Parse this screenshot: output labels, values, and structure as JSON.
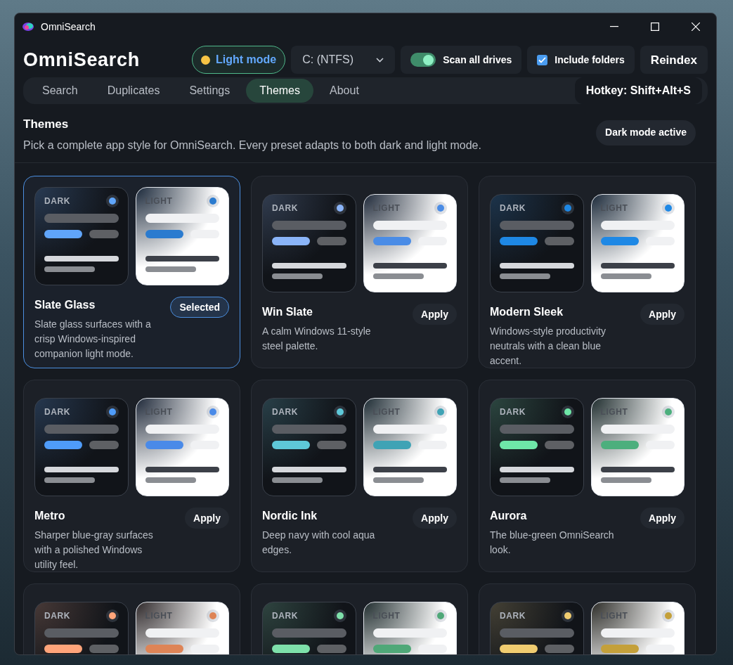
{
  "window": {
    "title": "OmniSearch"
  },
  "app_title": "OmniSearch",
  "toolbar": {
    "mode_button": {
      "label": "Light mode"
    },
    "drive": {
      "value": "C: (NTFS)"
    },
    "scan_all_drives": {
      "label": "Scan all drives",
      "on": true
    },
    "include_folders": {
      "label": "Include folders",
      "checked": true
    },
    "reindex": {
      "label": "Reindex"
    }
  },
  "tabs": [
    {
      "label": "Search",
      "selected": false
    },
    {
      "label": "Duplicates",
      "selected": false
    },
    {
      "label": "Settings",
      "selected": false
    },
    {
      "label": "Themes",
      "selected": true
    },
    {
      "label": "About",
      "selected": false
    }
  ],
  "hotkey": "Hotkey: Shift+Alt+S",
  "section": {
    "title": "Themes",
    "description": "Pick a complete app style for OmniSearch. Every preset adapts to both dark and light mode.",
    "status": "Dark mode active"
  },
  "themes": [
    {
      "name": "Slate Glass",
      "description": "Slate glass surfaces with a crisp Windows-inspired companion light mode.",
      "button": "Selected",
      "selected": true,
      "previews": [
        {
          "label": "DARK",
          "color": "#60a5fa"
        },
        {
          "label": "LIGHT",
          "color": "#2b7bcf"
        }
      ]
    },
    {
      "name": "Win Slate",
      "description": "A calm Windows 11-style steel palette.",
      "button": "Apply",
      "selected": false,
      "previews": [
        {
          "label": "DARK",
          "color": "#8ab4f8"
        },
        {
          "label": "LIGHT",
          "color": "#4a8ce6"
        }
      ]
    },
    {
      "name": "Modern Sleek",
      "description": "Windows-style productivity neutrals with a clean blue accent.",
      "button": "Apply",
      "selected": false,
      "previews": [
        {
          "label": "DARK",
          "color": "#1e88e5"
        },
        {
          "label": "LIGHT",
          "color": "#1e88e5"
        }
      ]
    },
    {
      "name": "Metro",
      "description": "Sharper blue-gray surfaces with a polished Windows utility feel.",
      "button": "Apply",
      "selected": false,
      "previews": [
        {
          "label": "DARK",
          "color": "#4f9cf9"
        },
        {
          "label": "LIGHT",
          "color": "#4a8ae8"
        }
      ]
    },
    {
      "name": "Nordic Ink",
      "description": "Deep navy with cool aqua edges.",
      "button": "Apply",
      "selected": false,
      "previews": [
        {
          "label": "DARK",
          "color": "#5ec8d8"
        },
        {
          "label": "LIGHT",
          "color": "#3fa3b5"
        }
      ]
    },
    {
      "name": "Aurora",
      "description": "The blue-green OmniSearch look.",
      "button": "Apply",
      "selected": false,
      "previews": [
        {
          "label": "DARK",
          "color": "#6ee7a8"
        },
        {
          "label": "LIGHT",
          "color": "#4caf7d"
        }
      ]
    },
    {
      "previews": [
        {
          "label": "DARK",
          "color": "#ffa47a"
        },
        {
          "label": "LIGHT",
          "color": "#de8456"
        }
      ]
    },
    {
      "previews": [
        {
          "label": "DARK",
          "color": "#7ee0aa"
        },
        {
          "label": "LIGHT",
          "color": "#4fa878"
        }
      ]
    },
    {
      "previews": [
        {
          "label": "DARK",
          "color": "#f0cc70"
        },
        {
          "label": "LIGHT",
          "color": "#c4a03a"
        }
      ]
    }
  ]
}
